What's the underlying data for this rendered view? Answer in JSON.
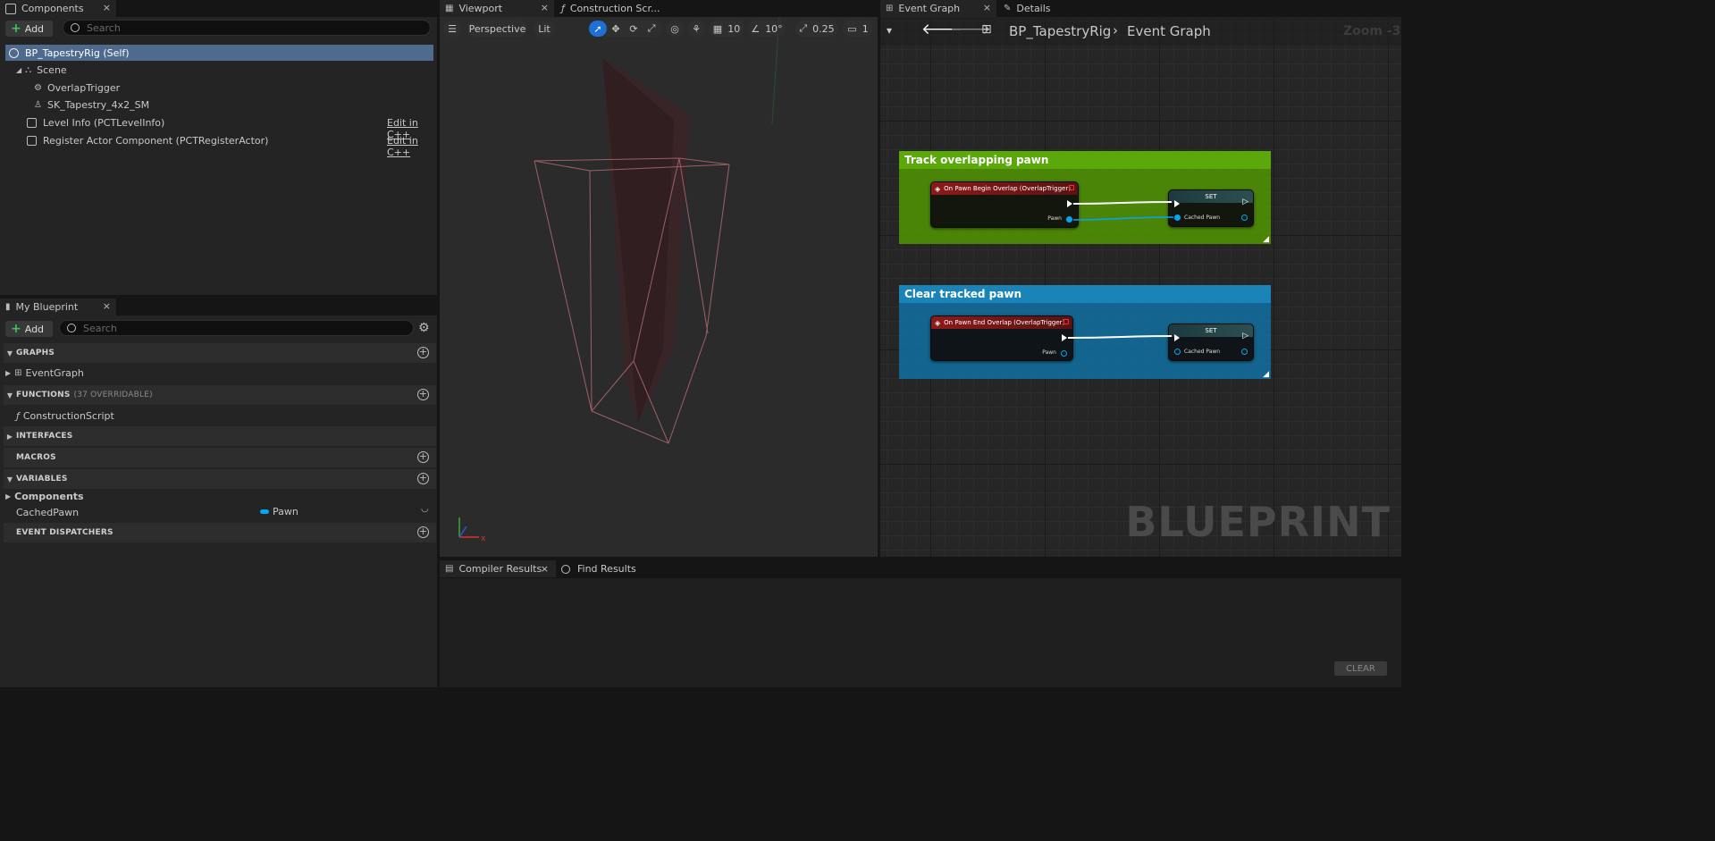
{
  "components": {
    "tab_label": "Components",
    "add_label": "Add",
    "search_placeholder": "Search",
    "items": [
      {
        "label": "BP_TapestryRig (Self)"
      },
      {
        "label": "Scene"
      },
      {
        "label": "OverlapTrigger"
      },
      {
        "label": "SK_Tapestry_4x2_SM"
      },
      {
        "label": "Level Info (PCTLevelInfo)",
        "action": "Edit in C++"
      },
      {
        "label": "Register Actor Component (PCTRegisterActor)",
        "action": "Edit in C++"
      }
    ]
  },
  "my_blueprint": {
    "tab_label": "My Blueprint",
    "add_label": "Add",
    "search_placeholder": "Search",
    "sections": {
      "graphs": "GRAPHS",
      "functions": "FUNCTIONS",
      "functions_sub": "(37 OVERRIDABLE)",
      "interfaces": "INTERFACES",
      "macros": "MACROS",
      "variables": "VARIABLES",
      "event_dispatchers": "EVENT DISPATCHERS"
    },
    "graph_item": "EventGraph",
    "function_item": "ConstructionScript",
    "variable_group": "Components",
    "variable": {
      "name": "CachedPawn",
      "type": "Pawn",
      "type_color": "#00a8f3"
    }
  },
  "viewport": {
    "tab_label": "Viewport",
    "tab2_label": "Construction Scr...",
    "perspective": "Perspective",
    "lit": "Lit",
    "grid_snap": "10",
    "rot_snap": "10°",
    "scale_snap": "0.25",
    "camera_speed": "1"
  },
  "event_graph": {
    "tab_label": "Event Graph",
    "details_tab": "Details",
    "breadcrumb_root": "BP_TapestryRig",
    "breadcrumb_leaf": "Event Graph",
    "zoom": "Zoom -3",
    "watermark": "BLUEPRINT",
    "comments": [
      {
        "title": "Track overlapping pawn",
        "color": "#56a000",
        "event": "On Pawn Begin Overlap (OverlapTrigger)",
        "event_pin": "Pawn",
        "set": "SET",
        "set_pin": "Cached Pawn"
      },
      {
        "title": "Clear tracked pawn",
        "color": "#0e77ad",
        "event": "On Pawn End Overlap (OverlapTrigger)",
        "event_pin": "Pawn",
        "set": "SET",
        "set_pin": "Cached Pawn"
      }
    ]
  },
  "bottom": {
    "compiler_tab": "Compiler Results",
    "find_tab": "Find Results",
    "clear": "CLEAR"
  }
}
